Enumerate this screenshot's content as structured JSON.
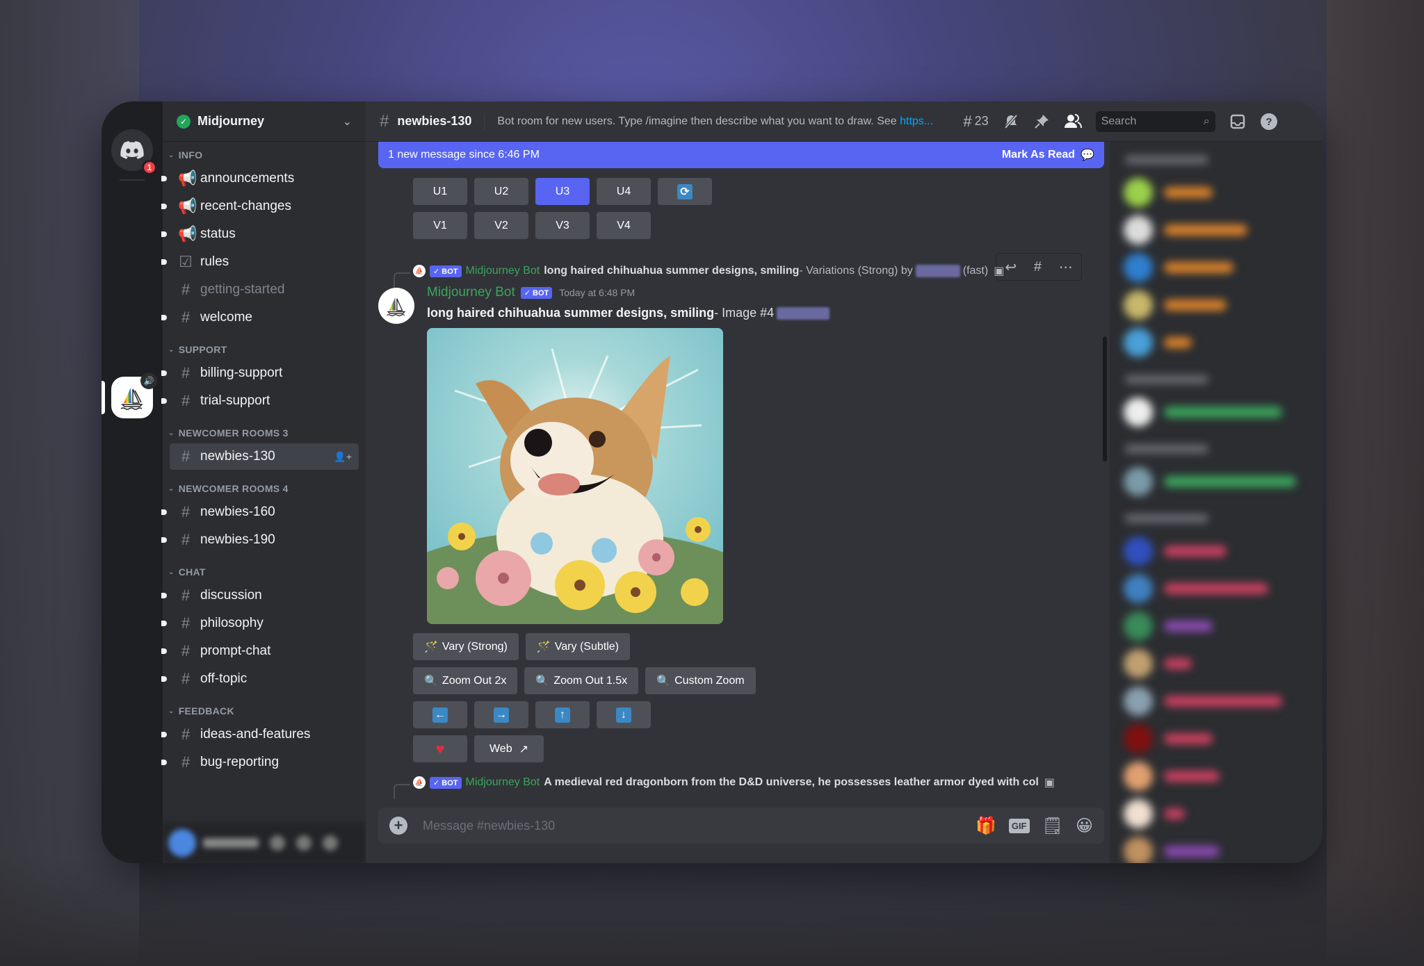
{
  "server": {
    "name": "Midjourney",
    "home_badge": "1"
  },
  "sidebar": {
    "categories": [
      {
        "label": "INFO",
        "channels": [
          {
            "name": "announcements",
            "icon": "megaphone-icon",
            "glyph": "📢",
            "unread": true
          },
          {
            "name": "recent-changes",
            "icon": "megaphone-icon",
            "glyph": "📢",
            "unread": true
          },
          {
            "name": "status",
            "icon": "megaphone-icon",
            "glyph": "📢",
            "unread": true
          },
          {
            "name": "rules",
            "icon": "rules-checkbox-icon",
            "glyph": "☑",
            "unread": true
          },
          {
            "name": "getting-started",
            "icon": "hash-icon",
            "glyph": "#",
            "unread": false
          },
          {
            "name": "welcome",
            "icon": "hash-icon",
            "glyph": "#",
            "unread": true
          }
        ]
      },
      {
        "label": "SUPPORT",
        "channels": [
          {
            "name": "billing-support",
            "icon": "hash-icon",
            "glyph": "#",
            "unread": true
          },
          {
            "name": "trial-support",
            "icon": "hash-icon",
            "glyph": "#",
            "unread": true
          }
        ]
      },
      {
        "label": "NEWCOMER ROOMS 3",
        "channels": [
          {
            "name": "newbies-130",
            "icon": "locked-thread-hash-icon",
            "glyph": "#",
            "unread": false,
            "active": true
          }
        ]
      },
      {
        "label": "NEWCOMER ROOMS 4",
        "channels": [
          {
            "name": "newbies-160",
            "icon": "thread-hash-icon",
            "glyph": "#",
            "unread": true
          },
          {
            "name": "newbies-190",
            "icon": "thread-hash-icon",
            "glyph": "#",
            "unread": true
          }
        ]
      },
      {
        "label": "CHAT",
        "channels": [
          {
            "name": "discussion",
            "icon": "hash-icon",
            "glyph": "#",
            "unread": true
          },
          {
            "name": "philosophy",
            "icon": "thread-hash-icon",
            "glyph": "#",
            "unread": true
          },
          {
            "name": "prompt-chat",
            "icon": "thread-hash-icon",
            "glyph": "#",
            "unread": true
          },
          {
            "name": "off-topic",
            "icon": "hash-icon",
            "glyph": "#",
            "unread": true
          }
        ]
      },
      {
        "label": "FEEDBACK",
        "channels": [
          {
            "name": "ideas-and-features",
            "icon": "hash-icon",
            "glyph": "#",
            "unread": true
          },
          {
            "name": "bug-reporting",
            "icon": "hash-icon",
            "glyph": "#",
            "unread": true
          }
        ]
      }
    ]
  },
  "topbar": {
    "channel": "newbies-130",
    "topic": "Bot room for new users. Type /imagine then describe what you want to draw. See ",
    "topic_link": "https...",
    "threads_count": "23",
    "search_placeholder": "Search"
  },
  "new_messages_bar": {
    "text": "1 new message since 6:46 PM",
    "action": "Mark As Read"
  },
  "previous_message": {
    "upscale_buttons": [
      "U1",
      "U2",
      "U3",
      "U4"
    ],
    "upscale_selected": "U3",
    "variation_buttons": [
      "V1",
      "V2",
      "V3",
      "V4"
    ]
  },
  "message": {
    "reply": {
      "bot_tag": "✓ BOT",
      "author": "Midjourney Bot",
      "prompt": "long haired chihuahua summer designs, smiling",
      "suffix": " - Variations (Strong) by ",
      "mode": "(fast)"
    },
    "author": "Midjourney Bot",
    "bot_tag": "✓ BOT",
    "timestamp": "Today at 6:48 PM",
    "prompt": "long haired chihuahua summer designs, smiling",
    "suffix": " - Image #4",
    "image_alt": "Illustration of a smiling long-haired chihuahua surrounded by summer flowers",
    "buttons": {
      "vary_strong": "Vary (Strong)",
      "vary_subtle": "Vary (Subtle)",
      "zoom_out_2x": "Zoom Out 2x",
      "zoom_out_15x": "Zoom Out 1.5x",
      "custom_zoom": "Custom Zoom",
      "web": "Web"
    }
  },
  "next_message": {
    "bot_tag": "✓ BOT",
    "author": "Midjourney Bot",
    "prompt": "A medieval red dragonborn from the D&D universe, he possesses leather armor dyed with col"
  },
  "composer": {
    "placeholder": "Message #newbies-130"
  },
  "members_blurred": true
}
